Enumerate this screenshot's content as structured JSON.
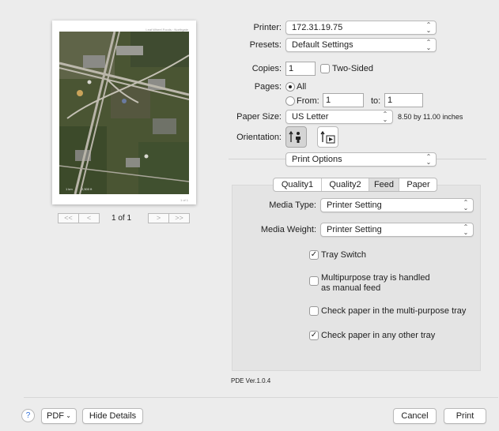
{
  "preview": {
    "map_credit": "Leaf Wheel Foods · Northgate",
    "scale_left": "1 km",
    "scale_right": "2,500 ft",
    "sheet_number": "1 of 1",
    "nav": {
      "first": "<<",
      "prev": "<",
      "next": ">",
      "last": ">>"
    },
    "page_indicator": "1 of 1"
  },
  "printer": {
    "label": "Printer:",
    "value": "172.31.19.75"
  },
  "presets": {
    "label": "Presets:",
    "value": "Default Settings"
  },
  "copies": {
    "label": "Copies:",
    "value": "1",
    "two_sided_label": "Two-Sided",
    "two_sided_checked": false
  },
  "pages": {
    "label": "Pages:",
    "all_label": "All",
    "from_label": "From:",
    "from_value": "1",
    "to_label": "to:",
    "to_value": "1",
    "selected": "All"
  },
  "paper_size": {
    "label": "Paper Size:",
    "value": "US Letter",
    "dimensions": "8.50 by 11.00 inches"
  },
  "orientation": {
    "label": "Orientation:",
    "selected": "portrait"
  },
  "section_popup": {
    "value": "Print Options"
  },
  "tabs": [
    {
      "label": "Quality1",
      "selected": false
    },
    {
      "label": "Quality2",
      "selected": false
    },
    {
      "label": "Feed",
      "selected": true
    },
    {
      "label": "Paper",
      "selected": false
    }
  ],
  "feed": {
    "media_type_label": "Media Type:",
    "media_type_value": "Printer Setting",
    "media_weight_label": "Media Weight:",
    "media_weight_value": "Printer Setting",
    "options": [
      {
        "label": "Tray Switch",
        "checked": true
      },
      {
        "label_line1": "Multipurpose tray is handled",
        "label_line2": "as manual feed",
        "checked": false
      },
      {
        "label": "Check paper in the multi-purpose tray",
        "checked": false
      },
      {
        "label": "Check paper in any other tray",
        "checked": true
      }
    ]
  },
  "pde_version": "PDE Ver.1.0.4",
  "bottom": {
    "help": "?",
    "pdf": "PDF",
    "hide_details": "Hide Details",
    "cancel": "Cancel",
    "print": "Print"
  },
  "colors": {
    "accent": "#2f6fd8",
    "selected_tab": "#dedede",
    "panel": "#e4e4e4"
  }
}
